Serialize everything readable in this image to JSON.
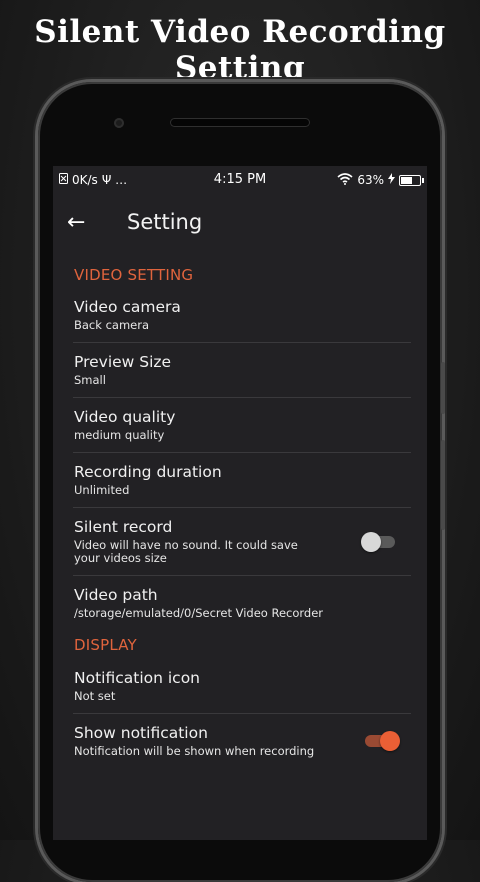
{
  "banner": {
    "title": "Silent Video Recording Setting"
  },
  "statusbar": {
    "network_speed": "0K/s",
    "extra_icons": "Ψ …",
    "time": "4:15 PM",
    "battery": "63%",
    "battery_level": 0.63
  },
  "toolbar": {
    "back_glyph": "←",
    "title": "Setting"
  },
  "sections": {
    "video": {
      "header": "VIDEO SETTING",
      "items": [
        {
          "title": "Video camera",
          "subtitle": "Back camera"
        },
        {
          "title": "Preview Size",
          "subtitle": "Small"
        },
        {
          "title": "Video quality",
          "subtitle": "medium quality"
        },
        {
          "title": "Recording duration",
          "subtitle": "Unlimited"
        },
        {
          "title": "Silent record",
          "subtitle": "Video will have no sound. It could save your videos size",
          "toggle": false
        },
        {
          "title": "Video path",
          "subtitle": "/storage/emulated/0/Secret Video Recorder"
        }
      ]
    },
    "display": {
      "header": "DISPLAY",
      "items": [
        {
          "title": "Notification icon",
          "subtitle": "Not set"
        },
        {
          "title": "Show notification",
          "subtitle": "Notification will be shown when recording",
          "toggle": true
        }
      ]
    }
  },
  "colors": {
    "accent": "#e0643d",
    "background": "#222124"
  }
}
